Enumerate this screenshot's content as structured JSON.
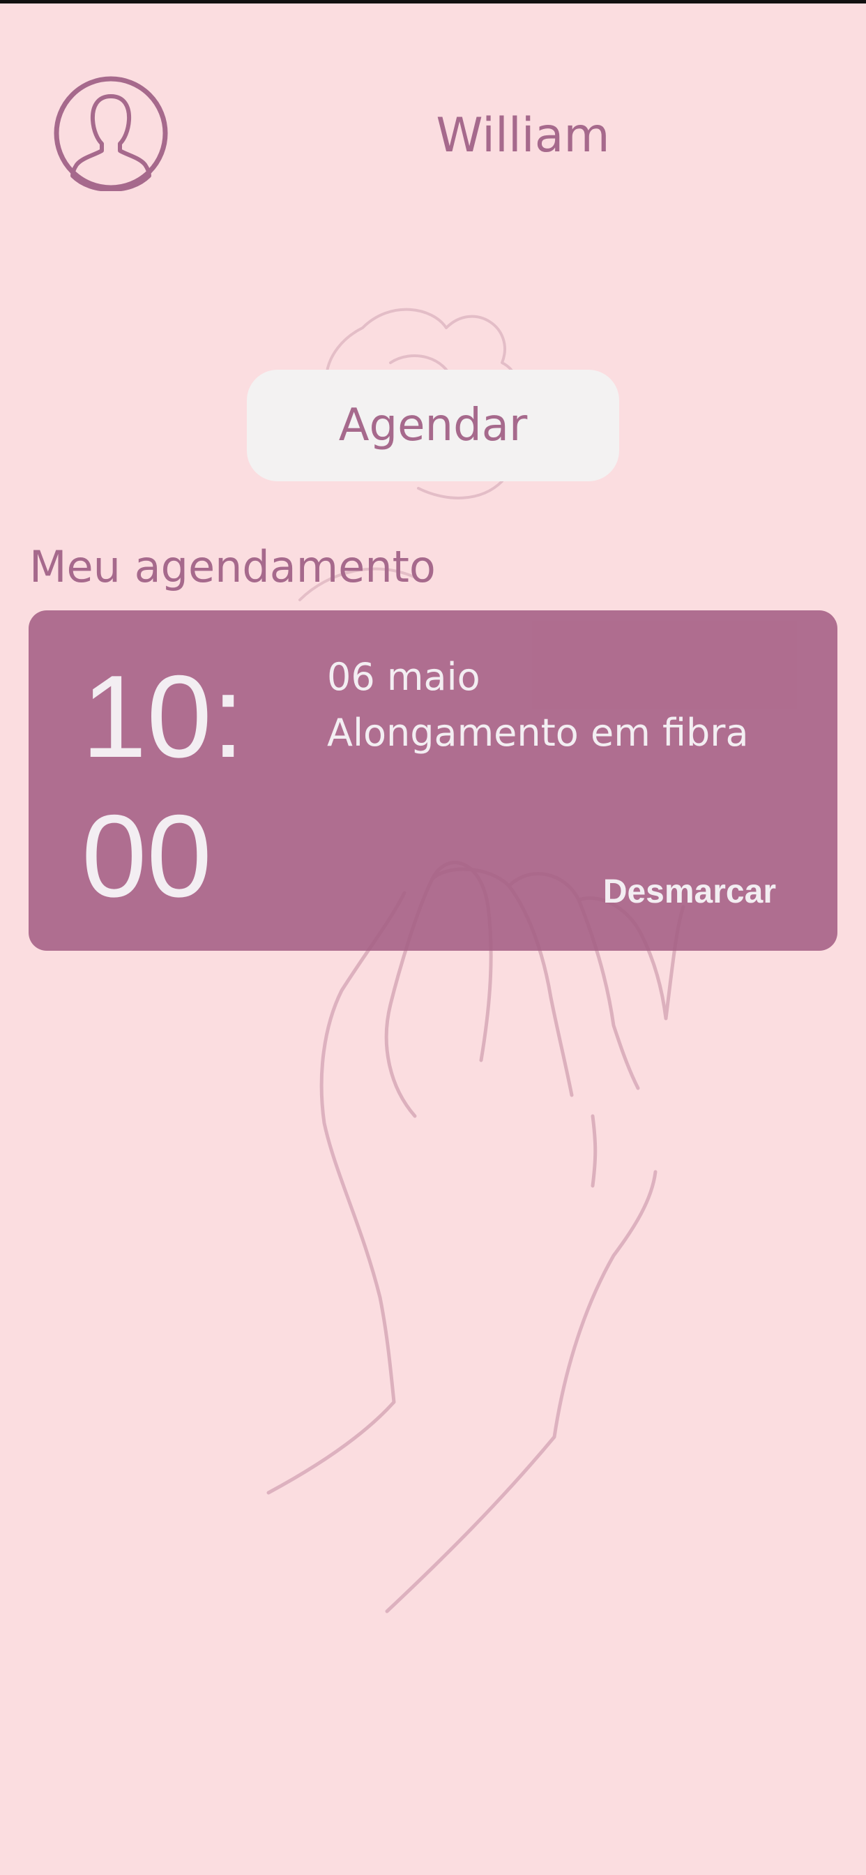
{
  "header": {
    "user_name": "William",
    "avatar_icon": "user-silhouette-icon"
  },
  "actions": {
    "schedule_label": "Agendar"
  },
  "appointments": {
    "section_title": "Meu agendamento",
    "items": [
      {
        "time": "10:00",
        "date": "06 maio",
        "service": "Alongamento em fibra",
        "cancel_label": "Desmarcar"
      }
    ]
  },
  "colors": {
    "background": "#fbdde0",
    "accent": "#a6698c",
    "card": "#ab6e8e",
    "button_bg": "#f3f2f2",
    "card_text": "#f3eef2"
  }
}
